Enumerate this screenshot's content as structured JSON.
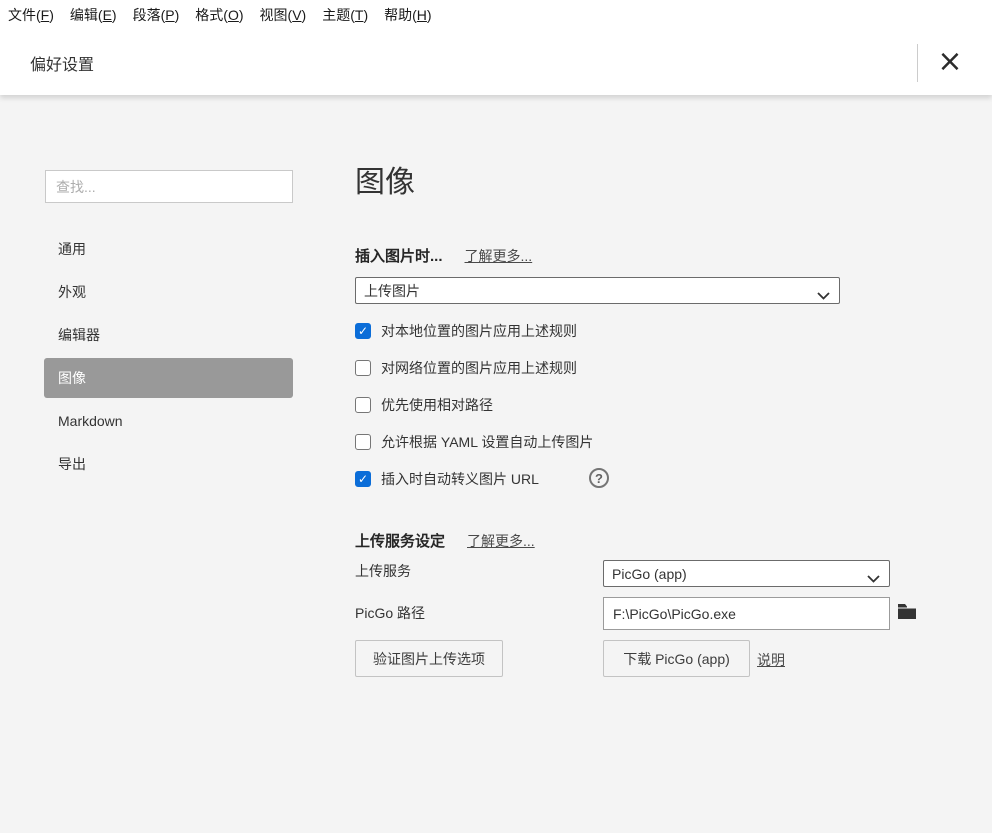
{
  "menu_bar": {
    "items": [
      {
        "pre": "文件(",
        "key": "F",
        "post": ")"
      },
      {
        "pre": "编辑(",
        "key": "E",
        "post": ")"
      },
      {
        "pre": "段落(",
        "key": "P",
        "post": ")"
      },
      {
        "pre": "格式(",
        "key": "O",
        "post": ")"
      },
      {
        "pre": "视图(",
        "key": "V",
        "post": ")"
      },
      {
        "pre": "主题(",
        "key": "T",
        "post": ")"
      },
      {
        "pre": "帮助(",
        "key": "H",
        "post": ")"
      }
    ]
  },
  "titlebar": {
    "title": "偏好设置",
    "close_glyph": "×"
  },
  "sidebar": {
    "search_placeholder": "查找...",
    "items": [
      {
        "label": "通用",
        "selected": false
      },
      {
        "label": "外观",
        "selected": false
      },
      {
        "label": "编辑器",
        "selected": false
      },
      {
        "label": "图像",
        "selected": true
      },
      {
        "label": "Markdown",
        "selected": false
      },
      {
        "label": "导出",
        "selected": false
      }
    ]
  },
  "main": {
    "heading": "图像",
    "insert_section": {
      "title": "插入图片时...",
      "learn_more": "了解更多...",
      "action_select_value": "上传图片",
      "checkboxes": [
        {
          "label": "对本地位置的图片应用上述规则",
          "checked": true
        },
        {
          "label": "对网络位置的图片应用上述规则",
          "checked": false
        },
        {
          "label": "优先使用相对路径",
          "checked": false
        },
        {
          "label": "允许根据 YAML 设置自动上传图片",
          "checked": false
        },
        {
          "label": "插入时自动转义图片 URL",
          "checked": true
        }
      ],
      "help_glyph": "?"
    },
    "upload_section": {
      "title": "上传服务设定",
      "learn_more": "了解更多...",
      "service_label": "上传服务",
      "service_value": "PicGo (app)",
      "path_label": "PicGo 路径",
      "path_value": "F:\\PicGo\\PicGo.exe",
      "validate_button": "验证图片上传选项",
      "download_button": "下载 PicGo (app)",
      "help_link": "说明"
    }
  },
  "colors": {
    "checkbox_accent": "#0b6dd8",
    "selected_item_bg": "#999999",
    "content_bg": "#f4f4f4"
  }
}
